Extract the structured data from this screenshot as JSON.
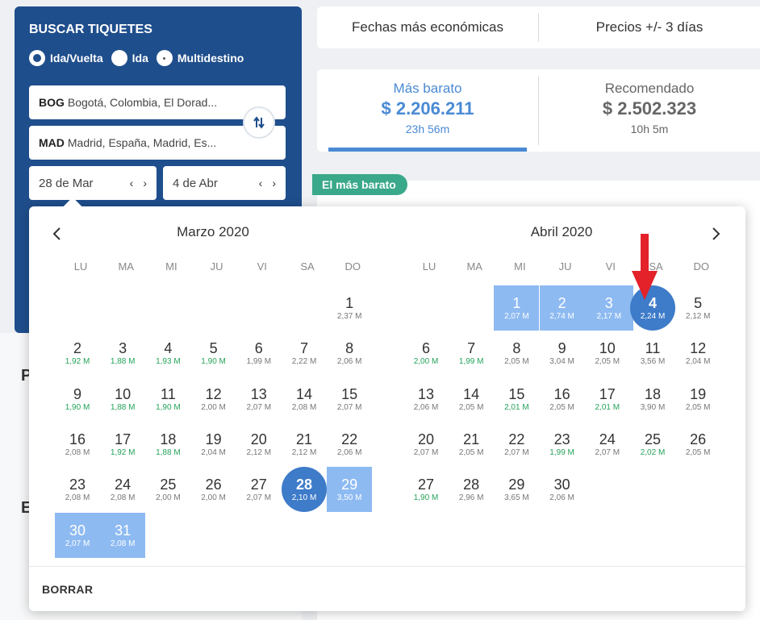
{
  "search": {
    "title": "BUSCAR TIQUETES",
    "trip_types": [
      {
        "label": "Ida/Vuelta",
        "selected": true
      },
      {
        "label": "Ida",
        "selected": false
      },
      {
        "label": "Multidestino",
        "selected": false
      }
    ],
    "origin": {
      "code": "BOG",
      "text": "Bogotá, Colombia, El Dorad..."
    },
    "destination": {
      "code": "MAD",
      "text": "Madrid, España, Madrid, Es..."
    },
    "depart_date": "28 de Mar",
    "return_date": "4 de Abr"
  },
  "tabs": [
    "Fechas más económicas",
    "Precios +/- 3 días"
  ],
  "price_options": [
    {
      "label": "Más barato",
      "price": "$ 2.206.211",
      "duration": "23h 56m",
      "active": true
    },
    {
      "label": "Recomendado",
      "price": "$ 2.502.323",
      "duration": "10h 5m",
      "active": false
    }
  ],
  "badge": "El más barato",
  "left_headings": [
    "P",
    "E"
  ],
  "calendar": {
    "weekdays": [
      "LU",
      "MA",
      "MI",
      "JU",
      "VI",
      "SA",
      "DO"
    ],
    "clear_label": "BORRAR",
    "months": [
      {
        "title": "Marzo 2020",
        "days": [
          {
            "d": "1",
            "p": "2,37 M",
            "row": 0,
            "col": 6
          },
          {
            "d": "2",
            "p": "1,92 M",
            "row": 1,
            "col": 0,
            "cheap": true
          },
          {
            "d": "3",
            "p": "1,88 M",
            "row": 1,
            "col": 1,
            "cheap": true
          },
          {
            "d": "4",
            "p": "1,93 M",
            "row": 1,
            "col": 2,
            "cheap": true
          },
          {
            "d": "5",
            "p": "1,90 M",
            "row": 1,
            "col": 3,
            "cheap": true
          },
          {
            "d": "6",
            "p": "1,99 M",
            "row": 1,
            "col": 4
          },
          {
            "d": "7",
            "p": "2,22 M",
            "row": 1,
            "col": 5
          },
          {
            "d": "8",
            "p": "2,06 M",
            "row": 1,
            "col": 6
          },
          {
            "d": "9",
            "p": "1,90 M",
            "row": 2,
            "col": 0,
            "cheap": true
          },
          {
            "d": "10",
            "p": "1,88 M",
            "row": 2,
            "col": 1,
            "cheap": true
          },
          {
            "d": "11",
            "p": "1,90 M",
            "row": 2,
            "col": 2,
            "cheap": true
          },
          {
            "d": "12",
            "p": "2,00 M",
            "row": 2,
            "col": 3
          },
          {
            "d": "13",
            "p": "2,07 M",
            "row": 2,
            "col": 4
          },
          {
            "d": "14",
            "p": "2,08 M",
            "row": 2,
            "col": 5
          },
          {
            "d": "15",
            "p": "2,07 M",
            "row": 2,
            "col": 6
          },
          {
            "d": "16",
            "p": "2,08 M",
            "row": 3,
            "col": 0
          },
          {
            "d": "17",
            "p": "1,92 M",
            "row": 3,
            "col": 1,
            "cheap": true
          },
          {
            "d": "18",
            "p": "1,88 M",
            "row": 3,
            "col": 2,
            "cheap": true
          },
          {
            "d": "19",
            "p": "2,04 M",
            "row": 3,
            "col": 3
          },
          {
            "d": "20",
            "p": "2,12 M",
            "row": 3,
            "col": 4
          },
          {
            "d": "21",
            "p": "2,12 M",
            "row": 3,
            "col": 5
          },
          {
            "d": "22",
            "p": "2,06 M",
            "row": 3,
            "col": 6
          },
          {
            "d": "23",
            "p": "2,08 M",
            "row": 4,
            "col": 0
          },
          {
            "d": "24",
            "p": "2,08 M",
            "row": 4,
            "col": 1
          },
          {
            "d": "25",
            "p": "2,00 M",
            "row": 4,
            "col": 2
          },
          {
            "d": "26",
            "p": "2,00 M",
            "row": 4,
            "col": 3
          },
          {
            "d": "27",
            "p": "2,07 M",
            "row": 4,
            "col": 4
          },
          {
            "d": "28",
            "p": "2,10 M",
            "row": 4,
            "col": 5,
            "state": "selected"
          },
          {
            "d": "29",
            "p": "3,50 M",
            "row": 4,
            "col": 6,
            "state": "range"
          },
          {
            "d": "30",
            "p": "2,07 M",
            "row": 5,
            "col": 0,
            "state": "range"
          },
          {
            "d": "31",
            "p": "2,08 M",
            "row": 5,
            "col": 1,
            "state": "range"
          }
        ]
      },
      {
        "title": "Abril 2020",
        "days": [
          {
            "d": "1",
            "p": "2,07 M",
            "row": 0,
            "col": 2,
            "state": "range"
          },
          {
            "d": "2",
            "p": "2,74 M",
            "row": 0,
            "col": 3,
            "state": "range"
          },
          {
            "d": "3",
            "p": "2,17 M",
            "row": 0,
            "col": 4,
            "state": "range"
          },
          {
            "d": "4",
            "p": "2,24 M",
            "row": 0,
            "col": 5,
            "state": "selected"
          },
          {
            "d": "5",
            "p": "2,12 M",
            "row": 0,
            "col": 6
          },
          {
            "d": "6",
            "p": "2,00 M",
            "row": 1,
            "col": 0,
            "cheap": true
          },
          {
            "d": "7",
            "p": "1,99 M",
            "row": 1,
            "col": 1,
            "cheap": true
          },
          {
            "d": "8",
            "p": "2,05 M",
            "row": 1,
            "col": 2
          },
          {
            "d": "9",
            "p": "3,04 M",
            "row": 1,
            "col": 3
          },
          {
            "d": "10",
            "p": "2,05 M",
            "row": 1,
            "col": 4
          },
          {
            "d": "11",
            "p": "3,56 M",
            "row": 1,
            "col": 5
          },
          {
            "d": "12",
            "p": "2,04 M",
            "row": 1,
            "col": 6
          },
          {
            "d": "13",
            "p": "2,06 M",
            "row": 2,
            "col": 0
          },
          {
            "d": "14",
            "p": "2,05 M",
            "row": 2,
            "col": 1
          },
          {
            "d": "15",
            "p": "2,01 M",
            "row": 2,
            "col": 2,
            "cheap": true
          },
          {
            "d": "16",
            "p": "2,05 M",
            "row": 2,
            "col": 3
          },
          {
            "d": "17",
            "p": "2,01 M",
            "row": 2,
            "col": 4,
            "cheap": true
          },
          {
            "d": "18",
            "p": "3,90 M",
            "row": 2,
            "col": 5
          },
          {
            "d": "19",
            "p": "2,05 M",
            "row": 2,
            "col": 6
          },
          {
            "d": "20",
            "p": "2,07 M",
            "row": 3,
            "col": 0
          },
          {
            "d": "21",
            "p": "2,05 M",
            "row": 3,
            "col": 1
          },
          {
            "d": "22",
            "p": "2,07 M",
            "row": 3,
            "col": 2
          },
          {
            "d": "23",
            "p": "1,99 M",
            "row": 3,
            "col": 3,
            "cheap": true
          },
          {
            "d": "24",
            "p": "2,07 M",
            "row": 3,
            "col": 4
          },
          {
            "d": "25",
            "p": "2,02 M",
            "row": 3,
            "col": 5,
            "cheap": true
          },
          {
            "d": "26",
            "p": "2,05 M",
            "row": 3,
            "col": 6
          },
          {
            "d": "27",
            "p": "1,90 M",
            "row": 4,
            "col": 0,
            "cheap": true
          },
          {
            "d": "28",
            "p": "2,96 M",
            "row": 4,
            "col": 1
          },
          {
            "d": "29",
            "p": "3,65 M",
            "row": 4,
            "col": 2
          },
          {
            "d": "30",
            "p": "2,06 M",
            "row": 4,
            "col": 3
          }
        ]
      }
    ]
  },
  "colors": {
    "brand": "#1f4e8c",
    "accent": "#4a8ad4",
    "range": "#8ebaf2",
    "selected": "#3e7bc9",
    "cheap": "#25a35a",
    "badge": "#3aa88a",
    "annotation": "#e3222a"
  }
}
